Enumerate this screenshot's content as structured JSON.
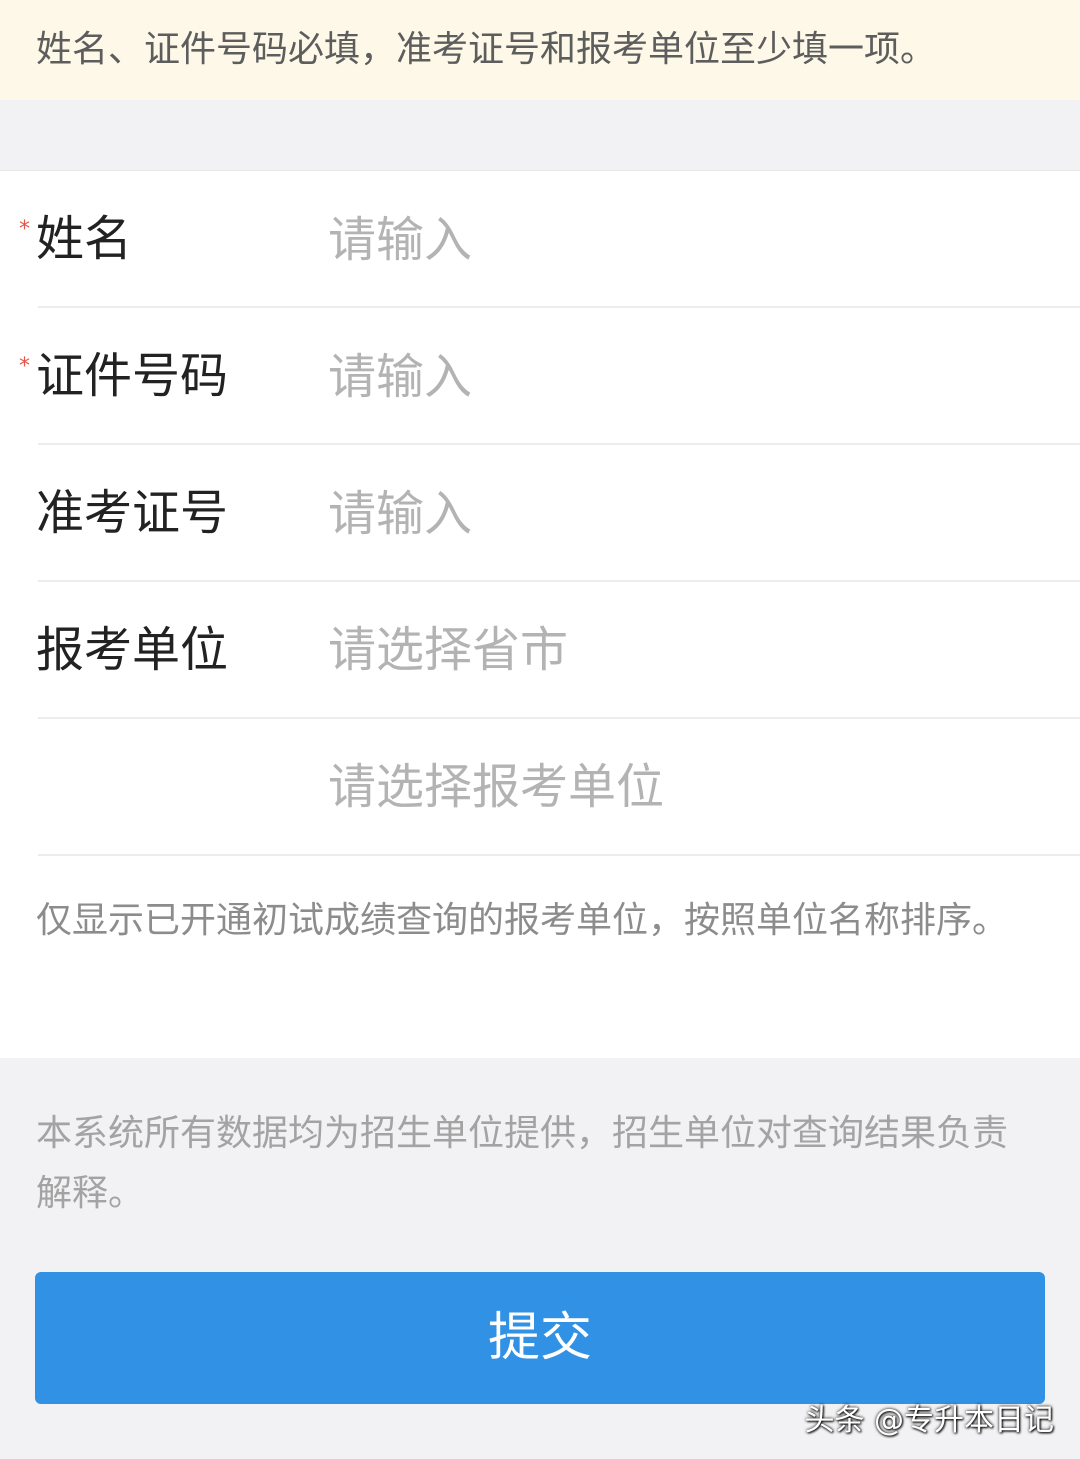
{
  "notice": {
    "text": "姓名、证件号码必填，准考证号和报考单位至少填一项。"
  },
  "form": {
    "required_mark": "*",
    "name": {
      "label": "姓名",
      "placeholder": "请输入",
      "value": ""
    },
    "id_number": {
      "label": "证件号码",
      "placeholder": "请输入",
      "value": ""
    },
    "admission_ticket": {
      "label": "准考证号",
      "placeholder": "请输入",
      "value": ""
    },
    "unit": {
      "label": "报考单位",
      "province_placeholder": "请选择省市",
      "unit_placeholder": "请选择报考单位"
    },
    "hint": "仅显示已开通初试成绩查询的报考单位，按照单位名称排序。"
  },
  "disclaimer": "本系统所有数据均为招生单位提供，招生单位对查询结果负责解释。",
  "submit": {
    "label": "提交"
  },
  "watermark": "头条 @专升本日记",
  "colors": {
    "notice_bg": "#fdf8e8",
    "required_star": "#e2574c",
    "submit_bg": "#3191e4",
    "placeholder": "#b3b3b3"
  }
}
